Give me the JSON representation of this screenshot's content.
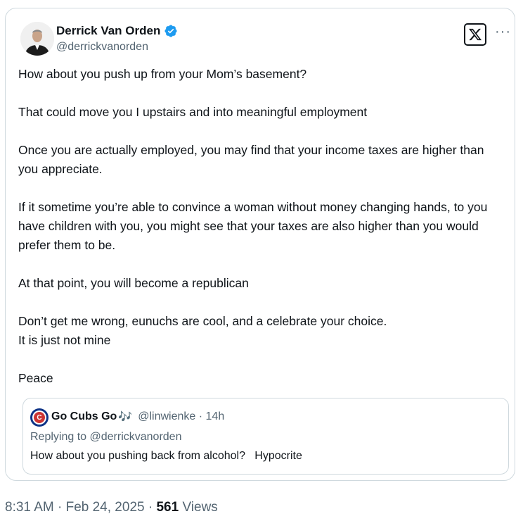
{
  "tweet": {
    "author_name": "Derrick Van Orden",
    "author_handle": "@derrickvanorden",
    "paragraphs": [
      "How about you push up from your Mom’s basement?",
      "That could move you I upstairs and into meaningful employment",
      "Once you are actually employed, you may find that your income taxes are higher than you appreciate.",
      "If it sometime you’re able to convince a woman without money changing hands, to you have children with you, you might see that your taxes are also higher than you would prefer them to be.",
      "At that point, you will become a republican",
      "Don’t get me wrong, eunuchs are cool, and a celebrate your choice.\nIt is just not mine",
      "Peace"
    ]
  },
  "quote": {
    "author_name": "Go Cubs Go",
    "emoji": "🎶",
    "handle_time": "@linwienke · 14h",
    "replying_to": "Replying to @derrickvanorden",
    "text": "How about you pushing back from alcohol?   Hypocrite",
    "avatar_letter": "C"
  },
  "footer": {
    "time_date": "8:31 AM · Feb 24, 2025 · ",
    "views_count": "561",
    "views_label": " Views"
  },
  "colors": {
    "verified": "#1d9bf0",
    "secondary_text": "#536471",
    "border": "#cfd9de"
  },
  "icons": {
    "logo": "x-logo-icon",
    "more": "more-options-icon",
    "badge": "verified-badge-icon"
  }
}
